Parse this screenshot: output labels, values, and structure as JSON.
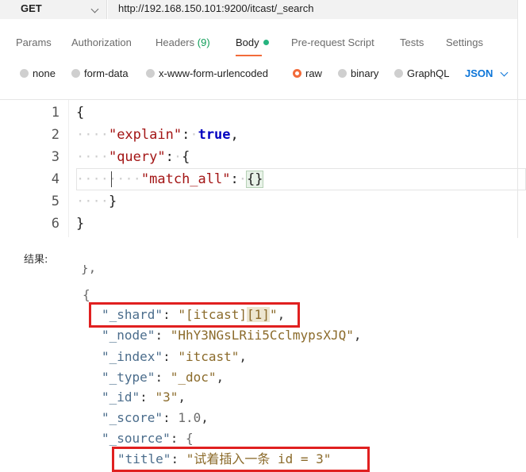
{
  "request": {
    "method": "GET",
    "url": "http://192.168.150.101:9200/itcast/_search"
  },
  "tabs": [
    {
      "label": "Params"
    },
    {
      "label": "Authorization"
    },
    {
      "label": "Headers",
      "count": "(9)"
    },
    {
      "label": "Body"
    },
    {
      "label": "Pre-request Script"
    },
    {
      "label": "Tests"
    },
    {
      "label": "Settings"
    }
  ],
  "body_options": {
    "items": [
      "none",
      "form-data",
      "x-www-form-urlencoded",
      "raw",
      "binary",
      "GraphQL"
    ],
    "selected": "raw",
    "format": "JSON"
  },
  "editor": {
    "line_numbers": [
      "1",
      "2",
      "3",
      "4",
      "5",
      "6"
    ],
    "lines": {
      "open": "{",
      "explain_key": "\"explain\"",
      "colon": ":",
      "explain_val": "true",
      "comma": ",",
      "query_key": "\"query\"",
      "brace_open": "{",
      "match_key": "\"match_all\"",
      "empty_obj": "{}",
      "brace_close": "}",
      "close": "}"
    }
  },
  "result": {
    "label": "结果:",
    "partial_top": "},",
    "open": "{",
    "fields": [
      {
        "key": "\"_shard\"",
        "value": "\"[itcast][1]\"",
        "shard_pre": "\"[itcast]",
        "shard_mid": "[1]",
        "shard_post": "\""
      },
      {
        "key": "\"_node\"",
        "value": "\"HhY3NGsLRii5CclmypsXJQ\""
      },
      {
        "key": "\"_index\"",
        "value": "\"itcast\""
      },
      {
        "key": "\"_type\"",
        "value": "\"_doc\""
      },
      {
        "key": "\"_id\"",
        "value": "\"3\""
      },
      {
        "key": "\"_score\"",
        "value": "1.0"
      },
      {
        "key": "\"_source\"",
        "value": "{"
      }
    ],
    "source_title_key": "\"title\"",
    "source_title_value": "\"试着插入一条 id = 3\""
  },
  "colors": {
    "accent": "#f26b3a",
    "body_dot": "#26b47f",
    "json_select": "#0c75d8",
    "highlight_box": "#e02020"
  }
}
